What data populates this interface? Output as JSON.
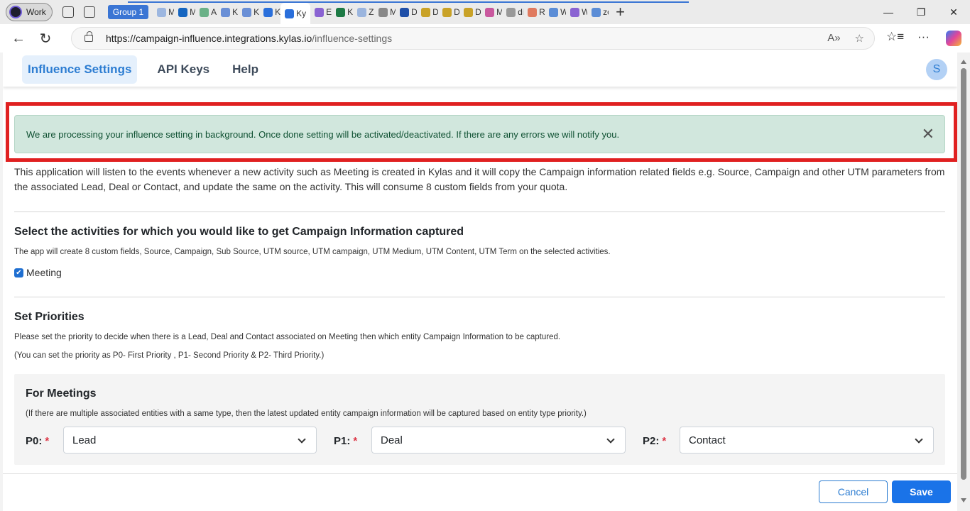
{
  "browser": {
    "profile": "Work",
    "group_label": "Group 1",
    "tabs": [
      {
        "label": "M",
        "color": "#9db7e0"
      },
      {
        "label": "M",
        "color": "#1565c0"
      },
      {
        "label": "Ac",
        "color": "#6ab187"
      },
      {
        "label": "Ky",
        "color": "#6a8fd6"
      },
      {
        "label": "Ky",
        "color": "#6a8fd6"
      },
      {
        "label": "Ky",
        "color": "#2a6fdb"
      },
      {
        "label": "Ky",
        "color": "#2a6fdb",
        "active": true
      },
      {
        "label": "Ex",
        "color": "#8a63d2"
      },
      {
        "label": "Ki",
        "color": "#1d7a45"
      },
      {
        "label": "Zc",
        "color": "#9bb5de"
      },
      {
        "label": "M",
        "color": "#888888"
      },
      {
        "label": "D",
        "color": "#1f4fa8"
      },
      {
        "label": "D",
        "color": "#c9a227"
      },
      {
        "label": "D",
        "color": "#c9a227"
      },
      {
        "label": "D",
        "color": "#c9a227"
      },
      {
        "label": "M",
        "color": "#c9589e"
      },
      {
        "label": "di",
        "color": "#999999"
      },
      {
        "label": "Re",
        "color": "#e07a5f"
      },
      {
        "label": "W",
        "color": "#5b8dd6"
      },
      {
        "label": "W",
        "color": "#8a63d2"
      },
      {
        "label": "zc",
        "color": "#5b8dd6"
      }
    ],
    "url_host": "https://campaign-influence.integrations.kylas.io",
    "url_path": "/influence-settings"
  },
  "nav": {
    "tabs": [
      "Influence Settings",
      "API Keys",
      "Help"
    ],
    "active": "Influence Settings",
    "avatar": "S"
  },
  "alert": {
    "text": "We are processing your influence setting in background. Once done setting will be activated/deactivated. If there are any errors we will notify you."
  },
  "description": "This application will listen to the events whenever a new activity such as Meeting is created in Kylas and it will copy the Campaign information related fields e.g. Source, Campaign and other UTM parameters from the associated Lead, Deal or Contact, and update the same on the activity. This will consume 8 custom fields from your quota.",
  "activities": {
    "heading": "Select the activities for which you would like to get Campaign Information captured",
    "subtext": "The app will create 8 custom fields, Source, Campaign, Sub Source, UTM source, UTM campaign, UTM Medium, UTM Content, UTM Term on the selected activities.",
    "checkbox_label": "Meeting",
    "checked": true
  },
  "priorities": {
    "heading": "Set Priorities",
    "line1": "Please set the priority to decide when there is a Lead, Deal and Contact associated on Meeting then which entity Campaign Information to be captured.",
    "line2": "(You can set the priority as P0- First Priority , P1- Second Priority & P2- Third Priority.)",
    "panel_title": "For Meetings",
    "panel_note": "(If there are multiple associated entities with a same type, then the latest updated entity campaign information will be captured based on entity type priority.)",
    "p0_label": "P0:",
    "p0_value": "Lead",
    "p1_label": "P1:",
    "p1_value": "Deal",
    "p2_label": "P2:",
    "p2_value": "Contact",
    "required_mark": "*"
  },
  "footer": {
    "cancel": "Cancel",
    "save": "Save"
  }
}
